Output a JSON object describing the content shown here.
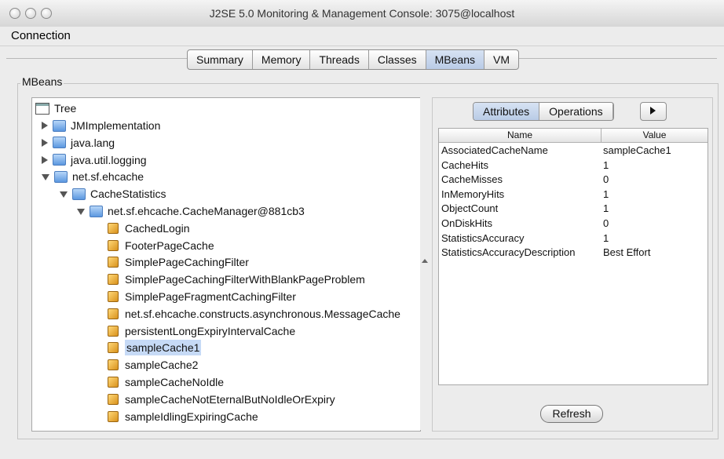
{
  "window": {
    "title": "J2SE 5.0 Monitoring & Management Console: 3075@localhost"
  },
  "menu": {
    "connection": "Connection"
  },
  "tabs": [
    "Summary",
    "Memory",
    "Threads",
    "Classes",
    "MBeans",
    "VM"
  ],
  "active_tab": "MBeans",
  "mbeans_label": "MBeans",
  "tree": {
    "root": "Tree",
    "nodes": [
      {
        "label": "JMImplementation",
        "level": 1,
        "expanded": false
      },
      {
        "label": "java.lang",
        "level": 1,
        "expanded": false
      },
      {
        "label": "java.util.logging",
        "level": 1,
        "expanded": false
      },
      {
        "label": "net.sf.ehcache",
        "level": 1,
        "expanded": true
      },
      {
        "label": "CacheStatistics",
        "level": 2,
        "expanded": true
      },
      {
        "label": "net.sf.ehcache.CacheManager@881cb3",
        "level": 3,
        "expanded": true
      },
      {
        "label": "CachedLogin",
        "level": 4
      },
      {
        "label": "FooterPageCache",
        "level": 4
      },
      {
        "label": "SimplePageCachingFilter",
        "level": 4
      },
      {
        "label": "SimplePageCachingFilterWithBlankPageProblem",
        "level": 4
      },
      {
        "label": "SimplePageFragmentCachingFilter",
        "level": 4
      },
      {
        "label": "net.sf.ehcache.constructs.asynchronous.MessageCache",
        "level": 4
      },
      {
        "label": "persistentLongExpiryIntervalCache",
        "level": 4
      },
      {
        "label": "sampleCache1",
        "level": 4,
        "selected": true
      },
      {
        "label": "sampleCache2",
        "level": 4
      },
      {
        "label": "sampleCacheNoIdle",
        "level": 4
      },
      {
        "label": "sampleCacheNotEternalButNoIdleOrExpiry",
        "level": 4
      },
      {
        "label": "sampleIdlingExpiringCache",
        "level": 4
      }
    ]
  },
  "subtabs": [
    "Attributes",
    "Operations"
  ],
  "active_subtab": "Attributes",
  "table": {
    "headers": {
      "name": "Name",
      "value": "Value"
    },
    "rows": [
      {
        "name": "AssociatedCacheName",
        "value": "sampleCache1"
      },
      {
        "name": "CacheHits",
        "value": "1"
      },
      {
        "name": "CacheMisses",
        "value": "0"
      },
      {
        "name": "InMemoryHits",
        "value": "1"
      },
      {
        "name": "ObjectCount",
        "value": "1"
      },
      {
        "name": "OnDiskHits",
        "value": "0"
      },
      {
        "name": "StatisticsAccuracy",
        "value": "1"
      },
      {
        "name": "StatisticsAccuracyDescription",
        "value": "Best Effort"
      }
    ]
  },
  "refresh_label": "Refresh"
}
